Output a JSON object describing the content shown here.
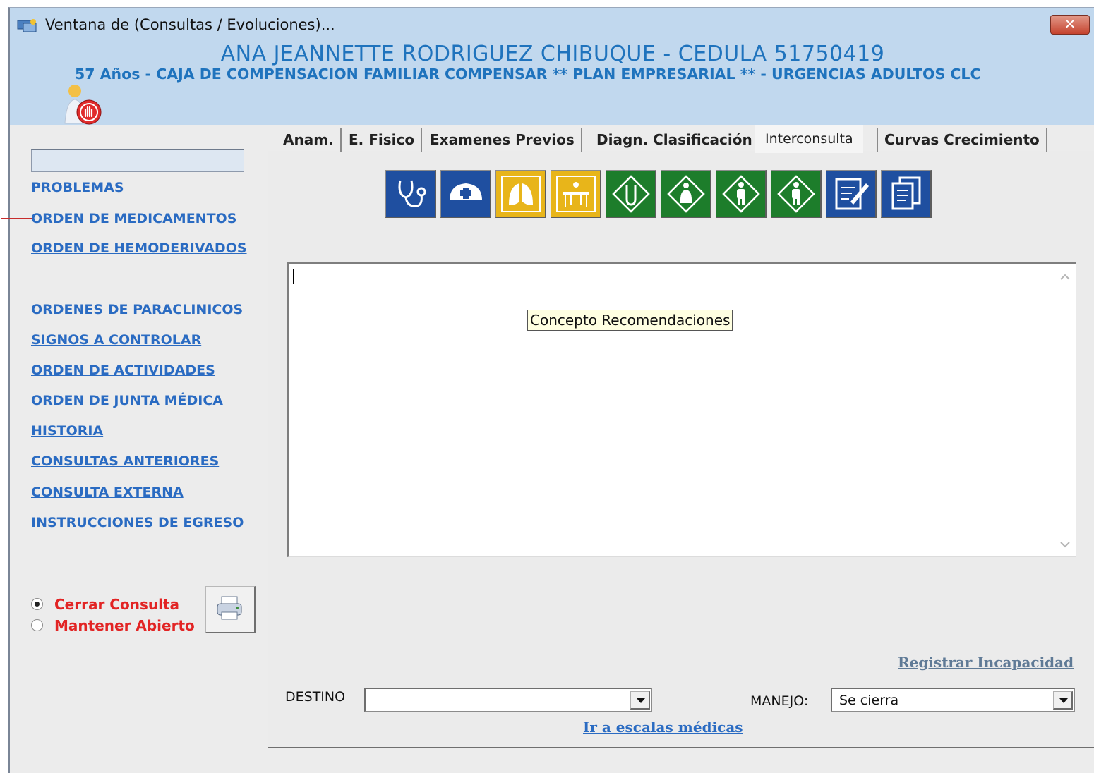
{
  "window": {
    "title": "Ventana de (Consultas / Evoluciones)...",
    "close_label": "✕"
  },
  "patient": {
    "name_line": "ANA JEANNETTE RODRIGUEZ CHIBUQUE  -  CEDULA 51750419",
    "info_line": "57 Años  -  CAJA DE COMPENSACION FAMILIAR COMPENSAR ** PLAN EMPRESARIAL ** - URGENCIAS ADULTOS CLC"
  },
  "sidebar": {
    "search_value": "",
    "links": [
      "PROBLEMAS",
      "ORDEN DE MEDICAMENTOS",
      "ORDEN DE HEMODERIVADOS",
      "ORDENES DE PARACLINICOS",
      "SIGNOS A CONTROLAR",
      "ORDEN DE ACTIVIDADES",
      "ORDEN DE JUNTA MÉDICA",
      "HISTORIA",
      "CONSULTAS ANTERIORES",
      "CONSULTA EXTERNA",
      "INSTRUCCIONES DE EGRESO"
    ],
    "radio_close": "Cerrar Consulta",
    "radio_keep": "Mantener Abierto",
    "selected_radio": "Cerrar Consulta"
  },
  "tabs": [
    {
      "label": "Anam."
    },
    {
      "label": "E. Fisico"
    },
    {
      "label": "Examenes Previos"
    },
    {
      "label": "Diagn. Clasificación"
    },
    {
      "label": "Interconsulta"
    },
    {
      "label": "Curvas Crecimiento"
    }
  ],
  "active_tab": "Interconsulta",
  "toolbar": {
    "buttons": [
      {
        "icon": "stethoscope-icon",
        "color": "#1f4fa0"
      },
      {
        "icon": "nurse-cap-icon",
        "color": "#1f4fa0"
      },
      {
        "icon": "lungs-icon",
        "color": "#e8b51a"
      },
      {
        "icon": "lab-desk-icon",
        "color": "#e8b51a"
      },
      {
        "icon": "test-tube-icon",
        "color": "#1d7d2b"
      },
      {
        "icon": "pregnant-woman-icon",
        "color": "#1d7d2b"
      },
      {
        "icon": "person-icon",
        "color": "#1d7d2b"
      },
      {
        "icon": "person-icon",
        "color": "#1d7d2b"
      },
      {
        "icon": "note-edit-icon",
        "color": "#1f4fa0"
      },
      {
        "icon": "documents-icon",
        "color": "#1f4fa0"
      }
    ]
  },
  "editor": {
    "value": "",
    "tooltip": "Concepto Recomendaciones"
  },
  "links": {
    "register_disability": "Registrar Incapacidad",
    "medical_scales": "Ir a escalas médicas"
  },
  "form": {
    "destino_label": "DESTINO",
    "destino_value": "",
    "manejo_label": "MANEJO:",
    "manejo_value": "Se cierra"
  },
  "colors": {
    "header_bg": "#c1d8ee",
    "accent_blue": "#1f73bd",
    "link_blue": "#2a6bc2",
    "radio_red": "#e22424",
    "serif_link": "#4b6b8c"
  }
}
